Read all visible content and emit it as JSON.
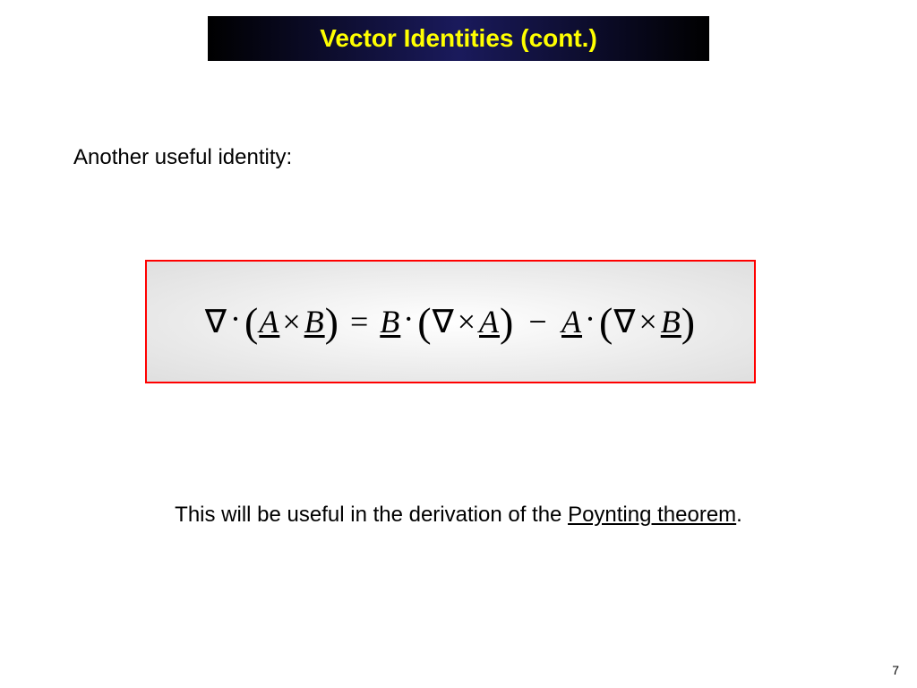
{
  "title": "Vector Identities (cont.)",
  "intro": "Another useful identity:",
  "equation": {
    "A": "A",
    "B": "B",
    "nabla": "∇",
    "dot": "·",
    "cross": "×",
    "eq": "=",
    "minus": "−",
    "lparen": "(",
    "rparen": ")"
  },
  "conclusion_prefix": "This will be useful in the derivation of the ",
  "conclusion_link": "Poynting theorem",
  "conclusion_suffix": ".",
  "page_number": "7"
}
